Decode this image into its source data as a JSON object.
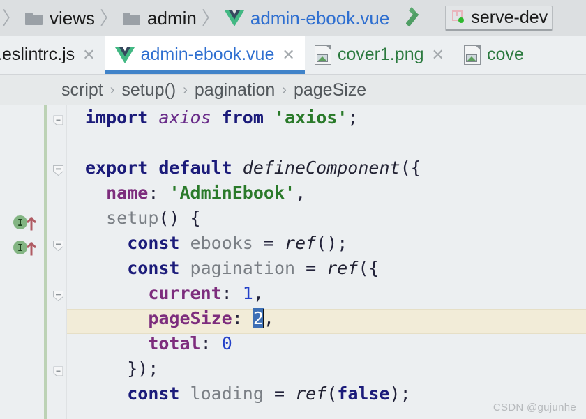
{
  "window": {
    "watermark": "CSDN @gujunhe"
  },
  "navbar": {
    "breadcrumbs": [
      {
        "label": "views",
        "icon": "folder-icon",
        "kind": "folder"
      },
      {
        "label": "admin",
        "icon": "folder-icon",
        "kind": "folder"
      },
      {
        "label": "admin-ebook.vue",
        "icon": "vue-icon",
        "kind": "file"
      }
    ],
    "separator": "〉",
    "build_icon": "hammer-icon",
    "run_config": {
      "label": "serve-dev",
      "icon": "run-configuration-icon",
      "status_dot_color": "#2eb82e"
    }
  },
  "tabs": [
    {
      "label": ".eslintrc.js",
      "icon": "js-file-icon",
      "type": "js",
      "active": false,
      "close": "✕"
    },
    {
      "label": "admin-ebook.vue",
      "icon": "vue-icon",
      "type": "vue",
      "active": true,
      "close": "✕"
    },
    {
      "label": "cover1.png",
      "icon": "image-file-icon",
      "type": "png",
      "active": false,
      "close": "✕"
    },
    {
      "label": "cove",
      "icon": "image-file-icon",
      "type": "png",
      "active": false,
      "close": ""
    }
  ],
  "structure_breadcrumb": {
    "separator": "›",
    "items": [
      "script",
      "setup()",
      "pagination",
      "pageSize"
    ]
  },
  "editor": {
    "current_line_index": 8,
    "selection": {
      "text": "2",
      "line_index": 8
    },
    "gutter_markers": [
      {
        "line_index": 4,
        "icon": "implemented-method-icon",
        "glyph": "I"
      },
      {
        "line_index": 5,
        "icon": "implemented-method-icon",
        "glyph": "I"
      }
    ],
    "fold_markers": [
      {
        "line_index": 0,
        "icon": "fold-end-icon"
      },
      {
        "line_index": 2,
        "icon": "fold-collapse-icon"
      },
      {
        "line_index": 5,
        "icon": "fold-collapse-icon"
      },
      {
        "line_index": 7,
        "icon": "fold-collapse-icon"
      },
      {
        "line_index": 10,
        "icon": "fold-end-icon"
      }
    ],
    "colors": {
      "background": "#eceff1",
      "current_line": "#f2ecd8",
      "vcs_modified_stripe": "#bcd2b5",
      "selection": "#3d6fb5",
      "keyword": "#1b1b7a",
      "string": "#2a7a2a",
      "number": "#2340c8",
      "property": "#7d2d7d",
      "identifier": "#7a7f85",
      "tab_underline": "#4083c9",
      "link": "#2f6fd0"
    },
    "lines": [
      {
        "index": 0,
        "tokens": [
          {
            "t": "import",
            "c": "kw"
          },
          {
            "t": " ",
            "c": "pl"
          },
          {
            "t": "axios",
            "c": "fnp"
          },
          {
            "t": " ",
            "c": "pl"
          },
          {
            "t": "from",
            "c": "kw"
          },
          {
            "t": " ",
            "c": "pl"
          },
          {
            "t": "'axios'",
            "c": "str"
          },
          {
            "t": ";",
            "c": "pl"
          }
        ]
      },
      {
        "index": 1,
        "tokens": []
      },
      {
        "index": 2,
        "tokens": [
          {
            "t": "export default ",
            "c": "kw"
          },
          {
            "t": "defineComponent",
            "c": "fn"
          },
          {
            "t": "({",
            "c": "pl"
          }
        ]
      },
      {
        "index": 3,
        "tokens": [
          {
            "t": "  ",
            "c": "pl"
          },
          {
            "t": "name",
            "c": "prop"
          },
          {
            "t": ": ",
            "c": "pl"
          },
          {
            "t": "'AdminEbook'",
            "c": "str"
          },
          {
            "t": ",",
            "c": "pl"
          }
        ]
      },
      {
        "index": 4,
        "tokens": [
          {
            "t": "  ",
            "c": "pl"
          },
          {
            "t": "setup",
            "c": "id"
          },
          {
            "t": "() {",
            "c": "pl"
          }
        ]
      },
      {
        "index": 5,
        "tokens": [
          {
            "t": "    ",
            "c": "pl"
          },
          {
            "t": "const",
            "c": "kw"
          },
          {
            "t": " ",
            "c": "pl"
          },
          {
            "t": "ebooks",
            "c": "id"
          },
          {
            "t": " = ",
            "c": "pl"
          },
          {
            "t": "ref",
            "c": "fn"
          },
          {
            "t": "();",
            "c": "pl"
          }
        ]
      },
      {
        "index": 6,
        "tokens": [
          {
            "t": "    ",
            "c": "pl"
          },
          {
            "t": "const",
            "c": "kw"
          },
          {
            "t": " ",
            "c": "pl"
          },
          {
            "t": "pagination",
            "c": "id"
          },
          {
            "t": " = ",
            "c": "pl"
          },
          {
            "t": "ref",
            "c": "fn"
          },
          {
            "t": "({",
            "c": "pl"
          }
        ]
      },
      {
        "index": 7,
        "tokens": [
          {
            "t": "      ",
            "c": "pl"
          },
          {
            "t": "current",
            "c": "prop"
          },
          {
            "t": ": ",
            "c": "pl"
          },
          {
            "t": "1",
            "c": "num"
          },
          {
            "t": ",",
            "c": "pl"
          }
        ]
      },
      {
        "index": 8,
        "tokens": [
          {
            "t": "      ",
            "c": "pl"
          },
          {
            "t": "pageSize",
            "c": "prop"
          },
          {
            "t": ": ",
            "c": "pl"
          },
          {
            "t": "2",
            "c": "sel"
          },
          {
            "t": "",
            "c": "caret"
          },
          {
            "t": ",",
            "c": "pl"
          }
        ]
      },
      {
        "index": 9,
        "tokens": [
          {
            "t": "      ",
            "c": "pl"
          },
          {
            "t": "total",
            "c": "prop"
          },
          {
            "t": ": ",
            "c": "pl"
          },
          {
            "t": "0",
            "c": "num"
          }
        ]
      },
      {
        "index": 10,
        "tokens": [
          {
            "t": "    });",
            "c": "pl"
          }
        ]
      },
      {
        "index": 11,
        "tokens": [
          {
            "t": "    ",
            "c": "pl"
          },
          {
            "t": "const",
            "c": "kw"
          },
          {
            "t": " ",
            "c": "pl"
          },
          {
            "t": "loading",
            "c": "id"
          },
          {
            "t": " = ",
            "c": "pl"
          },
          {
            "t": "ref",
            "c": "fn"
          },
          {
            "t": "(",
            "c": "pl"
          },
          {
            "t": "false",
            "c": "kw"
          },
          {
            "t": ");",
            "c": "pl"
          }
        ]
      }
    ]
  }
}
